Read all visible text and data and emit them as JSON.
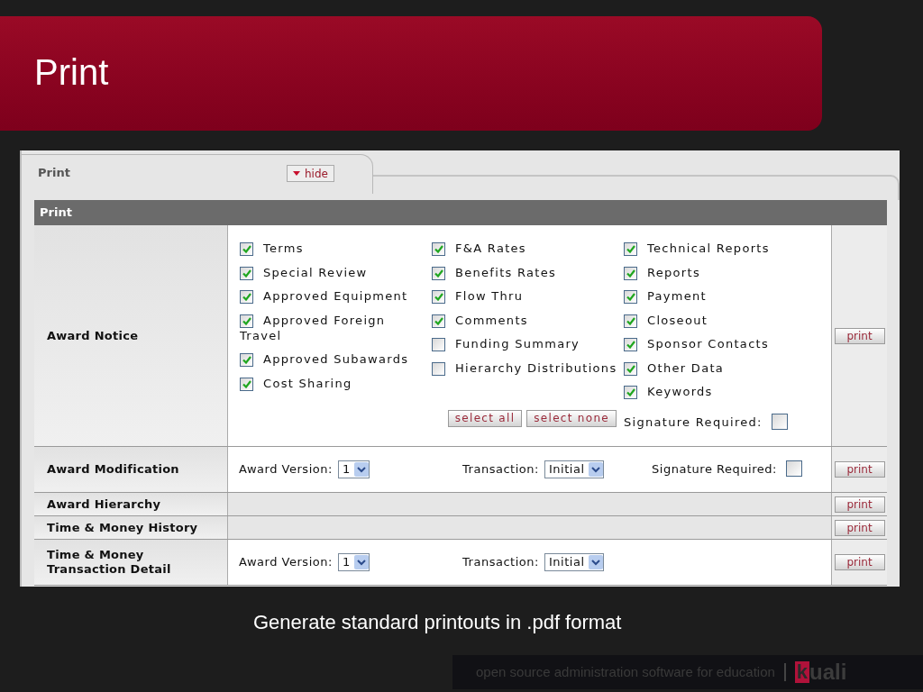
{
  "slide_title": "Print",
  "panel": {
    "tab": "Print",
    "hide_button": "hide",
    "header": "Print"
  },
  "rows": [
    {
      "kind": "notice",
      "label": "Award Notice",
      "columns": [
        [
          {
            "label": "Terms",
            "checked": true
          },
          {
            "label": "Special Review",
            "checked": true
          },
          {
            "label": "Approved Equipment",
            "checked": true
          },
          {
            "label": "Approved Foreign Travel",
            "checked": true
          },
          {
            "label": "Approved Subawards",
            "checked": true
          },
          {
            "label": "Cost Sharing",
            "checked": true
          }
        ],
        [
          {
            "label": "F&A Rates",
            "checked": true
          },
          {
            "label": "Benefits Rates",
            "checked": true
          },
          {
            "label": "Flow Thru",
            "checked": true
          },
          {
            "label": "Comments",
            "checked": true
          },
          {
            "label": "Funding Summary",
            "checked": false
          },
          {
            "label": "Hierarchy Distributions",
            "checked": false
          }
        ],
        [
          {
            "label": "Technical Reports",
            "checked": true
          },
          {
            "label": "Reports",
            "checked": true
          },
          {
            "label": "Payment",
            "checked": true
          },
          {
            "label": "Closeout",
            "checked": true
          },
          {
            "label": "Sponsor Contacts",
            "checked": true
          },
          {
            "label": "Other Data",
            "checked": true
          },
          {
            "label": "Keywords",
            "checked": true
          }
        ]
      ],
      "buttons": [
        "select all",
        "select none"
      ],
      "signature": {
        "label": "Signature Required:",
        "checked": false
      },
      "print": "print"
    },
    {
      "kind": "options",
      "label": "Award Modification",
      "award_version": {
        "label": "Award Version:",
        "value": "1"
      },
      "transaction": {
        "label": "Transaction:",
        "value": "Initial"
      },
      "signature": {
        "label": "Signature Required:",
        "checked": false
      },
      "print": "print"
    },
    {
      "kind": "plain",
      "label": "Award Hierarchy",
      "print": "print"
    },
    {
      "kind": "plain",
      "label": "Time & Money History",
      "print": "print"
    },
    {
      "kind": "options",
      "label": "Time & Money Transaction Detail",
      "award_version": {
        "label": "Award Version:",
        "value": "1"
      },
      "transaction": {
        "label": "Transaction:",
        "value": "Initial"
      },
      "print": "print"
    }
  ],
  "caption": "Generate standard printouts in .pdf format",
  "footer": {
    "tagline": "open source administration software for education",
    "logo_mark": "k",
    "logo_text": "uali"
  }
}
